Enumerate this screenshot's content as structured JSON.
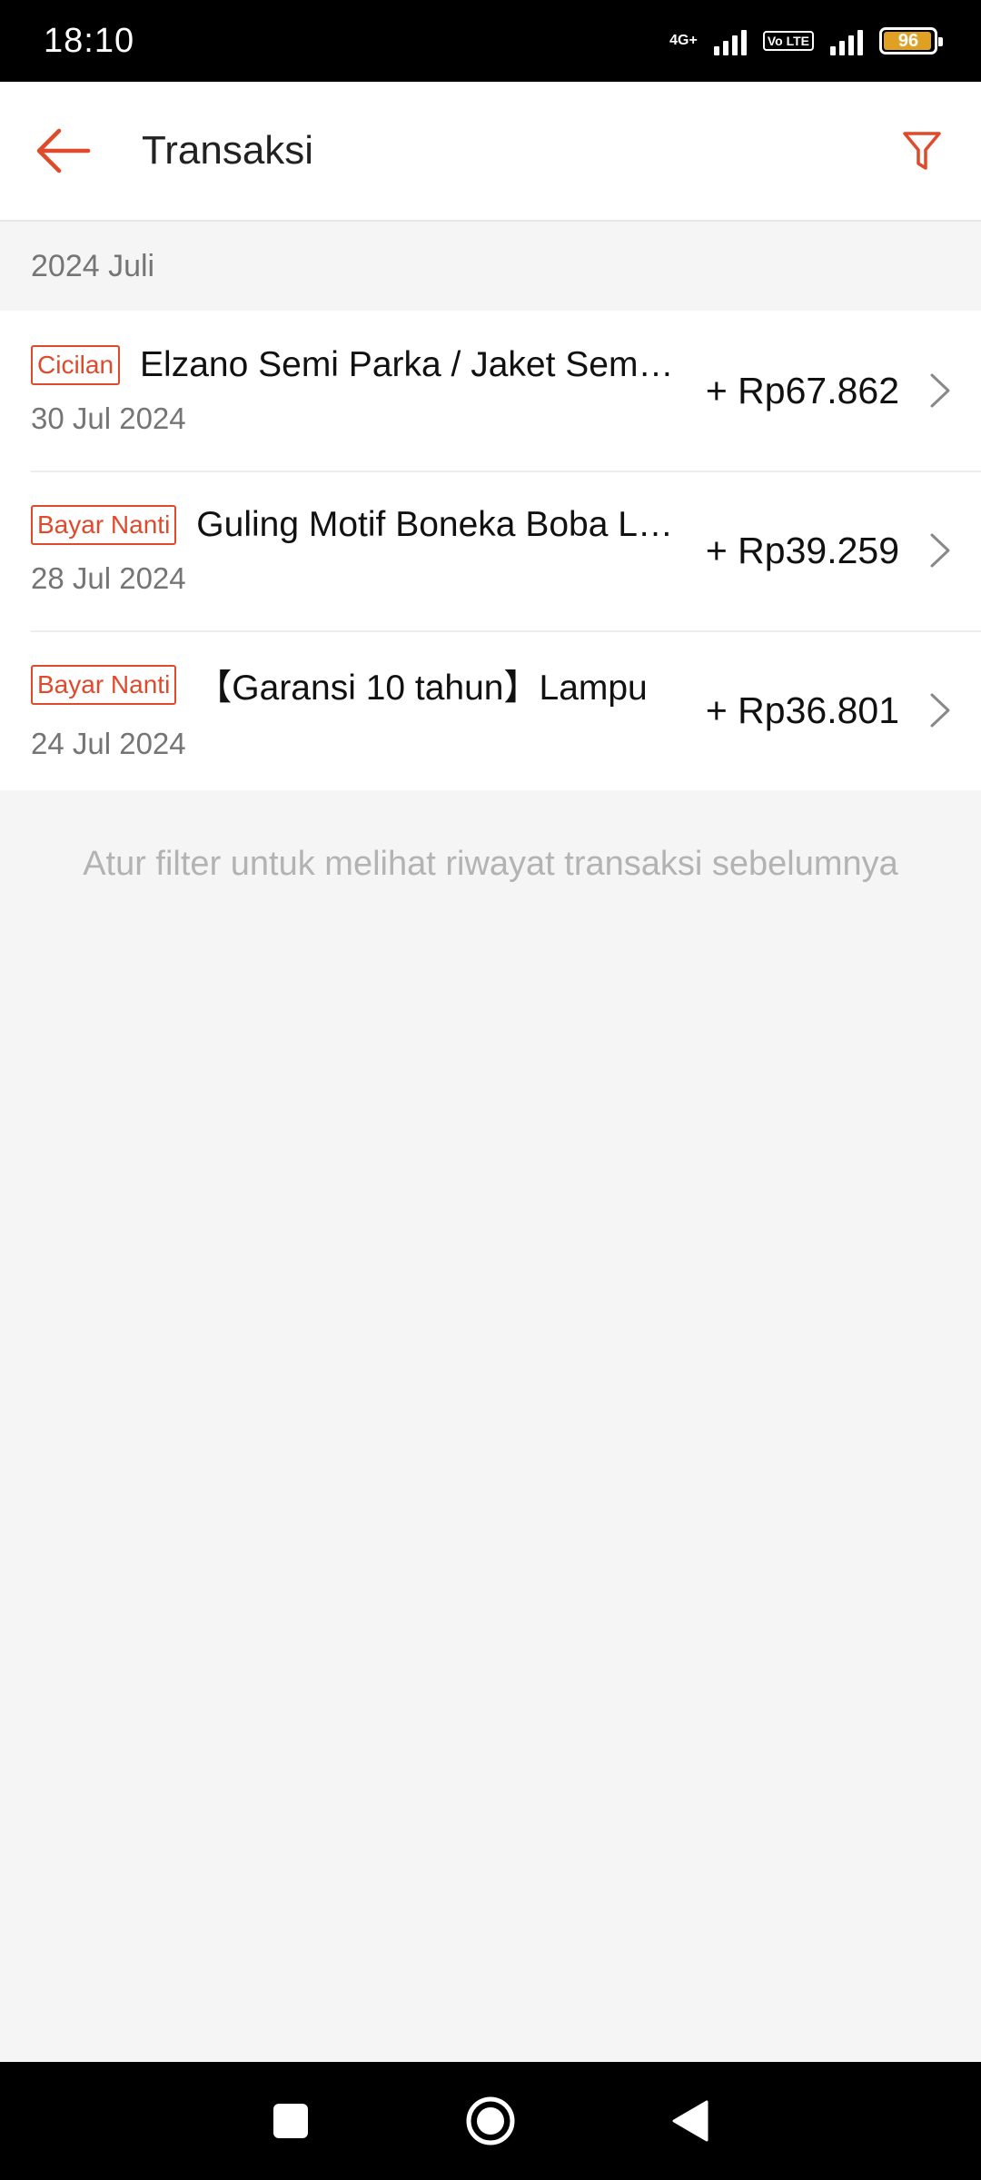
{
  "status_bar": {
    "time": "18:10",
    "network_label": "4G+",
    "volte_label": "Vo LTE",
    "battery_level": "96"
  },
  "header": {
    "title": "Transaksi",
    "back_icon": "arrow-left-icon",
    "filter_icon": "filter-icon",
    "accent_color": "#e0492a"
  },
  "month": {
    "label": "2024 Juli"
  },
  "transactions": [
    {
      "badge": "Cicilan",
      "name": "Elzano Semi Parka / Jaket Semi Parka",
      "date": "30 Jul 2024",
      "amount": "+ Rp67.862"
    },
    {
      "badge": "Bayar Nanti",
      "name": "Guling Motif Boneka Boba Lucu",
      "date": "28 Jul 2024",
      "amount": "+ Rp39.259"
    },
    {
      "badge": "Bayar Nanti",
      "name": "【Garansi 10 tahun】Lampu",
      "date": "24 Jul 2024",
      "amount": "+ Rp36.801"
    }
  ],
  "footer_hint": "Atur filter untuk melihat riwayat transaksi sebelumnya",
  "nav": {
    "recents": "square-icon",
    "home": "circle-icon",
    "back": "triangle-back-icon"
  }
}
